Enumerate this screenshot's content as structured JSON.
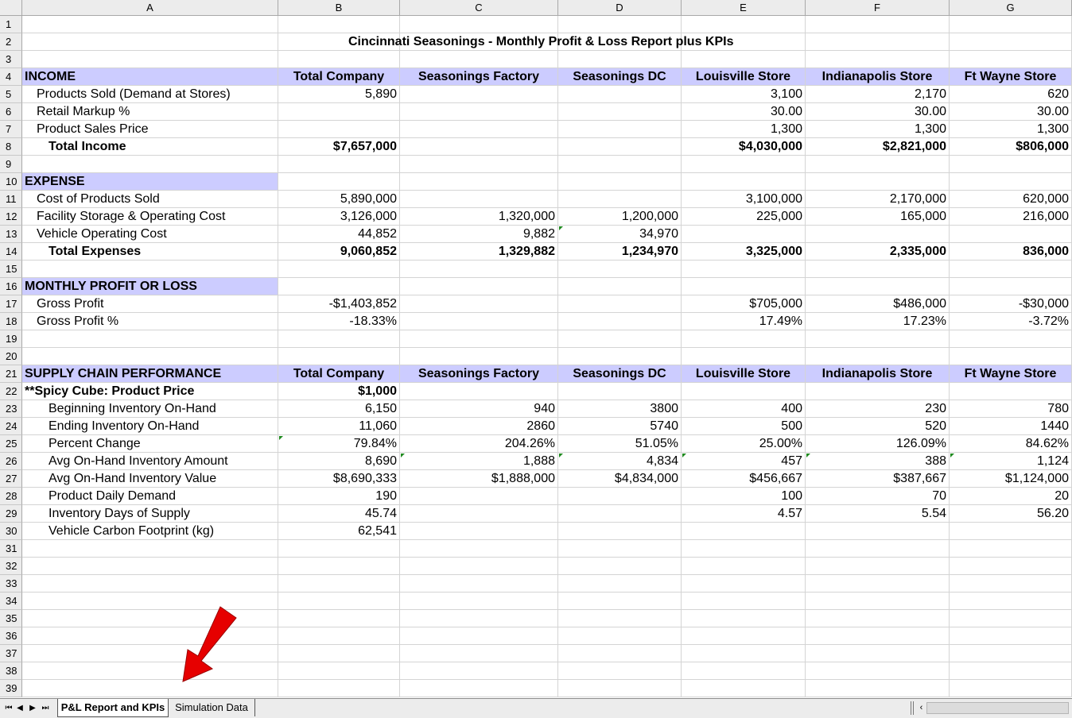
{
  "column_headers": [
    "A",
    "B",
    "C",
    "D",
    "E",
    "F",
    "G"
  ],
  "rows": [
    {
      "n": "1",
      "cells": []
    },
    {
      "n": "2",
      "cells": [],
      "title": "Cincinnati Seasonings - Monthly Profit & Loss Report plus KPIs"
    },
    {
      "n": "3",
      "cells": []
    },
    {
      "n": "4",
      "section": true,
      "cells": [
        "INCOME",
        "Total Company",
        "Seasonings Factory",
        "Seasonings DC",
        "Louisville Store",
        "Indianapolis Store",
        "Ft Wayne Store"
      ]
    },
    {
      "n": "5",
      "indent": 1,
      "cells": [
        "Products Sold (Demand at Stores)",
        "5,890",
        "",
        "",
        "3,100",
        "2,170",
        "620"
      ]
    },
    {
      "n": "6",
      "indent": 1,
      "cells": [
        "Retail Markup %",
        "",
        "",
        "",
        "30.00",
        "30.00",
        "30.00"
      ]
    },
    {
      "n": "7",
      "indent": 1,
      "cells": [
        "Product Sales Price",
        "",
        "",
        "",
        "1,300",
        "1,300",
        "1,300"
      ]
    },
    {
      "n": "8",
      "indent": 2,
      "bold": true,
      "cells": [
        "Total Income",
        "$7,657,000",
        "",
        "",
        "$4,030,000",
        "$2,821,000",
        "$806,000"
      ]
    },
    {
      "n": "9",
      "cells": []
    },
    {
      "n": "10",
      "section": true,
      "sectionOnlyA": true,
      "cells": [
        "EXPENSE"
      ]
    },
    {
      "n": "11",
      "indent": 1,
      "cells": [
        "Cost of Products Sold",
        "5,890,000",
        "",
        "",
        "3,100,000",
        "2,170,000",
        "620,000"
      ]
    },
    {
      "n": "12",
      "indent": 1,
      "cells": [
        "Facility Storage & Operating Cost",
        "3,126,000",
        "1,320,000",
        "1,200,000",
        "225,000",
        "165,000",
        "216,000"
      ]
    },
    {
      "n": "13",
      "indent": 1,
      "cells": [
        "Vehicle Operating Cost",
        "44,852",
        "9,882",
        "34,970",
        "",
        "",
        ""
      ]
    },
    {
      "n": "14",
      "indent": 2,
      "bold": true,
      "cells": [
        "Total Expenses",
        "9,060,852",
        "1,329,882",
        "1,234,970",
        "3,325,000",
        "2,335,000",
        "836,000"
      ]
    },
    {
      "n": "15",
      "cells": []
    },
    {
      "n": "16",
      "section": true,
      "sectionOnlyA": true,
      "cells": [
        "MONTHLY PROFIT OR LOSS"
      ]
    },
    {
      "n": "17",
      "indent": 1,
      "cells": [
        "Gross Profit",
        "-$1,403,852",
        "",
        "",
        "$705,000",
        "$486,000",
        "-$30,000"
      ]
    },
    {
      "n": "18",
      "indent": 1,
      "cells": [
        "Gross Profit %",
        "-18.33%",
        "",
        "",
        "17.49%",
        "17.23%",
        "-3.72%"
      ]
    },
    {
      "n": "19",
      "cells": []
    },
    {
      "n": "20",
      "cells": []
    },
    {
      "n": "21",
      "section": true,
      "cells": [
        "SUPPLY CHAIN PERFORMANCE",
        "Total Company",
        "Seasonings Factory",
        "Seasonings DC",
        "Louisville Store",
        "Indianapolis Store",
        "Ft Wayne Store"
      ]
    },
    {
      "n": "22",
      "boldAB": true,
      "cells": [
        "**Spicy Cube: Product Price",
        "$1,000",
        "",
        "",
        "",
        "",
        ""
      ]
    },
    {
      "n": "23",
      "indent": 2,
      "cells": [
        "Beginning Inventory On-Hand",
        "6,150",
        "940",
        "3800",
        "400",
        "230",
        "780"
      ]
    },
    {
      "n": "24",
      "indent": 2,
      "cells": [
        "Ending Inventory On-Hand",
        "11,060",
        "2860",
        "5740",
        "500",
        "520",
        "1440"
      ]
    },
    {
      "n": "25",
      "indent": 2,
      "cells": [
        "Percent Change",
        "79.84%",
        "204.26%",
        "51.05%",
        "25.00%",
        "126.09%",
        "84.62%"
      ]
    },
    {
      "n": "26",
      "indent": 2,
      "cells": [
        "Avg On-Hand Inventory Amount",
        "8,690",
        "1,888",
        "4,834",
        "457",
        "388",
        "1,124"
      ]
    },
    {
      "n": "27",
      "indent": 2,
      "cells": [
        "Avg On-Hand Inventory Value",
        "$8,690,333",
        "$1,888,000",
        "$4,834,000",
        "$456,667",
        "$387,667",
        "$1,124,000"
      ]
    },
    {
      "n": "28",
      "indent": 2,
      "cells": [
        "Product Daily Demand",
        "190",
        "",
        "",
        "100",
        "70",
        "20"
      ]
    },
    {
      "n": "29",
      "indent": 2,
      "cells": [
        "Inventory Days of Supply",
        "45.74",
        "",
        "",
        "4.57",
        "5.54",
        "56.20"
      ]
    },
    {
      "n": "30",
      "indent": 2,
      "cells": [
        "Vehicle Carbon Footprint (kg)",
        "62,541",
        "",
        "",
        "",
        "",
        ""
      ]
    },
    {
      "n": "31",
      "cells": []
    },
    {
      "n": "32",
      "cells": []
    },
    {
      "n": "33",
      "cells": []
    },
    {
      "n": "34",
      "cells": []
    },
    {
      "n": "35",
      "cells": []
    },
    {
      "n": "36",
      "cells": []
    },
    {
      "n": "37",
      "cells": []
    },
    {
      "n": "38",
      "cells": []
    },
    {
      "n": "39",
      "cells": []
    }
  ],
  "tabs": {
    "active": "P&L Report and KPIs",
    "inactive": "Simulation Data"
  },
  "nav_icons": [
    "first-sheet-icon",
    "prev-sheet-icon",
    "next-sheet-icon",
    "last-sheet-icon"
  ],
  "colors": {
    "section_fill": "#ccccff",
    "arrow": "#e60000",
    "error_indicator": "#1f8a1f"
  }
}
